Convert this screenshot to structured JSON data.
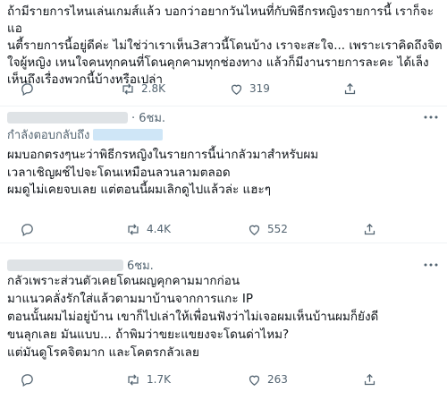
{
  "tweets": [
    {
      "text": "ถ้ามีรายการไหนเล่นเกมส์แล้ว บอกว่าอยากวันไหนที่กับพิธีกรหญิงรายการนี้ เราก็จะแอ\nนตี้รายการนี้อยู่ดีค่ะ ไม่ใช่ว่าเราเห็น3สาวนี้โดนบ้าง เราจะสะใจ... เพราะเราคิดถึงจิต\nใจผู้หญิง เหนใจคนทุกคนที่โดนคุกคามทุกช่องทาง แล้วก็มีงานรายการละคะ ได้เล็ง\nเห็นถึงเรื่องพวกนี้บ้างหรือเปล่า",
      "replies": "",
      "retweets": "2.8K",
      "likes": "319"
    },
    {
      "time": "· 6ชม.",
      "reply_label": "กำลังตอบกลับถึง",
      "text": "ผมบอกตรงๆนะว่าพิธีกรหญิงในรายการนี้น่ากลัวมาสำหรับผม\nเวลาเชิญผช์ไปจะโดนเหมือนลวนลามตลอด\nผมดูไม่เคยจบเลย แต่ตอนนี้ผมเลิกดูไปแล้วล่ะ แฮะๆ",
      "replies": "",
      "retweets": "4.4K",
      "likes": "552"
    },
    {
      "time": "6ชม.",
      "text": "กลัวเพราะส่วนตัวเคยโดนผญคุกคามมากก่อน\nมาแนวคลั่งรักใส่แล้วตามมาบ้านจากการแกะ IP\nตอนนั้นผมไม่อยู่บ้าน เขาก็ไปเล่าให้เพื่อนฟังว่าไม่เจอผมเห็นบ้านผมก็ยังดี\nขนลุกเลย มันแบบ... ถ้าพิมว่าขยะแขยงจะโดนด่าไหม?\nแต่มันดูโรคจิตมาก และโคตรกลัวเลย",
      "replies": "",
      "retweets": "1.7K",
      "likes": "263"
    }
  ],
  "icons": {
    "reply": "reply-icon",
    "retweet": "retweet-icon",
    "like": "heart-icon",
    "share": "share-icon",
    "more": "more-icon"
  },
  "colors": {
    "text": "#0f1419",
    "muted": "#536471",
    "link": "#1d9bf0",
    "divider": "#eff3f4"
  }
}
